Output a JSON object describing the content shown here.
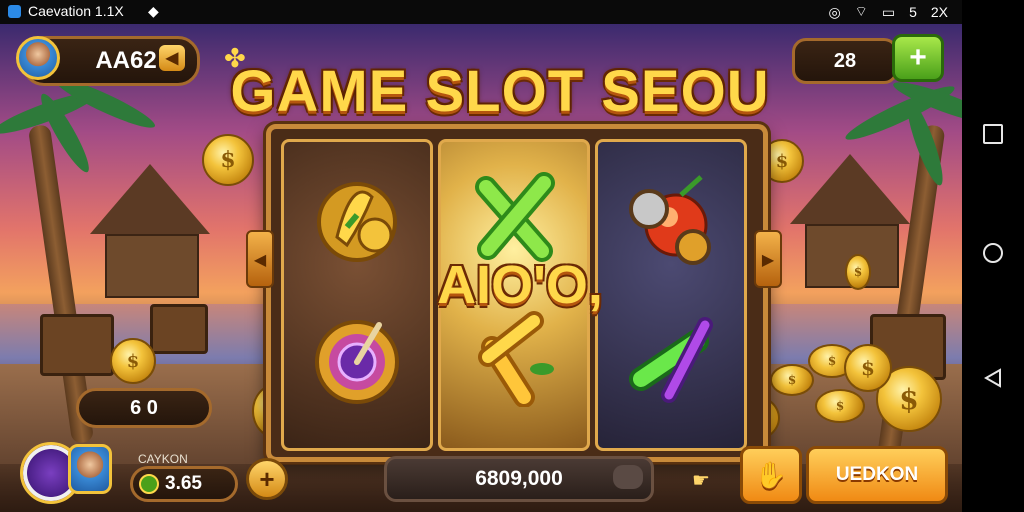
{
  "status_bar": {
    "app_label": "Caevation 1.1X",
    "icons_right": [
      "location-icon",
      "wifi-icon",
      "battery-icon"
    ],
    "right_text_1": "5",
    "right_text_2": "2X"
  },
  "game": {
    "title": "GAME SLOT SEOU",
    "center_banner": "AIO'O,",
    "player_name": "AA62",
    "top_right_value": "28",
    "left_value": "6 0",
    "bottom_label": "CAYKON",
    "bottom_balance": "3.65",
    "bet_amount": "6809,000",
    "action_button": "UEDKON"
  },
  "colors": {
    "title_gold": "#ffd84a",
    "frame_brown": "#4a2c17",
    "accent_orange": "#f08a14",
    "accent_green": "#4aa01a"
  },
  "reels": [
    {
      "top": "golden-scroll-icon",
      "bottom": "purple-gem-icon"
    },
    {
      "top": "green-x-icon",
      "bottom": "gold-bar-icon"
    },
    {
      "top": "red-bomb-icon",
      "bottom": "purple-green-bar-icon"
    }
  ]
}
